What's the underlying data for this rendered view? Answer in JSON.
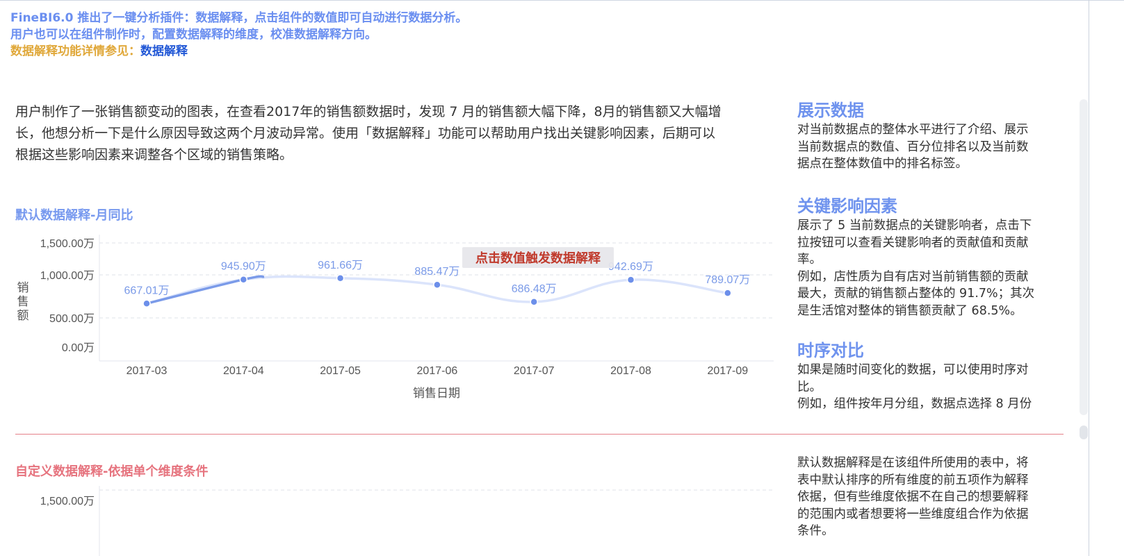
{
  "banner": {
    "line1": "FineBI6.0 推出了一键分析插件：数据解释，点击组件的数值即可自动进行数据分析。",
    "line2": "用户也可以在组件制作时，配置数据解释的维度，校准数据解释方向。",
    "line3_prefix": "数据解释功能详情参见：",
    "line3_link": "数据解释"
  },
  "intro": {
    "line1": "用户制作了一张销售额变动的图表，在查看2017年的销售额数据时，发现 7 月的销售额大幅下降，8月的销售额又大幅增",
    "line2": "长，他想分析一下是什么原因导致这两个月波动异常。使用「数据解释」功能可以帮助用户找出关键影响因素，后期可以",
    "line3": "根据这些影响因素来调整各个区域的销售策略。"
  },
  "section1": {
    "title": "默认数据解释-月同比"
  },
  "section2": {
    "title": "自定义数据解释-依据单个维度条件"
  },
  "colors": {
    "accent_blue": "#6f93ee",
    "line_dark": "#7b9be9",
    "line_light": "#dbe4fb",
    "tooltip_text": "#c0392b",
    "separator": "#e57f88"
  },
  "chart_data": {
    "type": "line",
    "x": [
      "2017-03",
      "2017-04",
      "2017-05",
      "2017-06",
      "2017-07",
      "2017-08",
      "2017-09"
    ],
    "series": [
      {
        "values": [
          667.01,
          945.9,
          961.66,
          885.47,
          686.48,
          942.69,
          789.07
        ]
      }
    ],
    "data_labels": [
      "667.01万",
      "945.90万",
      "961.66万",
      "885.47万",
      "686.48万",
      "942.69万",
      "789.07万"
    ],
    "yticks": [
      "0.00万",
      "500.00万",
      "1,000.00万",
      "1,500.00万"
    ],
    "xlabel": "销售日期",
    "ylabel": "销售额",
    "ylim": [
      0,
      1500
    ],
    "grid": true,
    "tooltip": "点击数值触发数据解释"
  },
  "chart2": {
    "ytick_top": "1,500.00万"
  },
  "sidebar": {
    "blocks": [
      {
        "title": "展示数据",
        "lines": [
          "对当前数据点的整体水平进行了介绍、展示",
          "当前数据点的数值、百分位排名以及当前数",
          "据点在整体数值中的排名标签。"
        ]
      },
      {
        "title": "关键影响因素",
        "lines": [
          "展示了 5 当前数据点的关键影响者，点击下",
          "拉按钮可以查看关键影响者的贡献值和贡献",
          "率。",
          "例如，店性质为自有店对当前销售额的贡献",
          "最大，贡献的销售额占整体的 91.7%；其次",
          "是生活馆对整体的销售额贡献了 68.5%。"
        ]
      },
      {
        "title": "时序对比",
        "lines": [
          "如果是随时间变化的数据，可以使用时序对",
          "比。",
          "例如，组件按年月分组，数据点选择 8 月份"
        ]
      }
    ]
  },
  "sidebar2": {
    "lines": [
      "默认数据解释是在该组件所使用的表中，将",
      "表中默认排序的所有维度的前五项作为解释",
      "依据，但有些维度依据不在自己的想要解释",
      "的范围内或者想要将一些维度组合作为依据",
      "条件。"
    ]
  }
}
